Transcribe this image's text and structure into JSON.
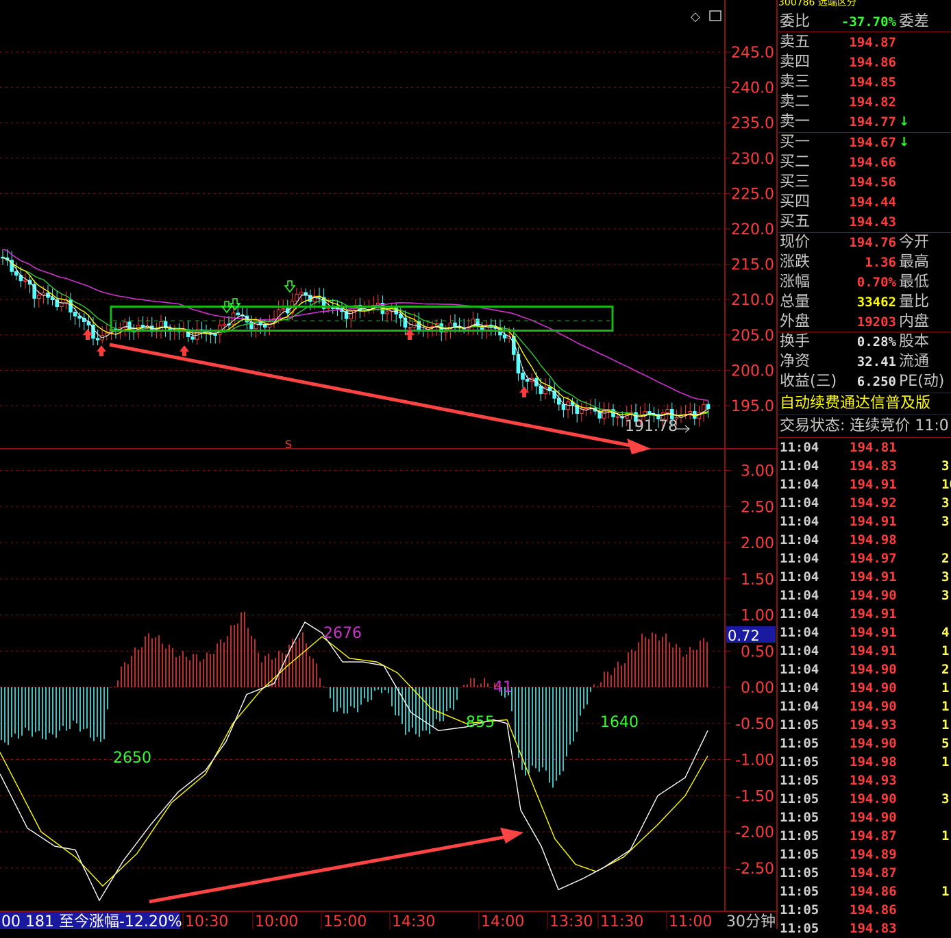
{
  "stock": {
    "code_fragment": "300",
    "header_clip": "300786 远端区分"
  },
  "price_axis": {
    "ticks": [
      "245.0",
      "240.0",
      "235.0",
      "230.0",
      "225.0",
      "220.0",
      "215.0",
      "210.0",
      "205.0",
      "200.0",
      "195.0"
    ]
  },
  "macd_axis": {
    "ticks": [
      "3.00",
      "2.50",
      "2.00",
      "1.50",
      "1.00",
      "0.50",
      "0.00",
      "-0.50",
      "-1.00",
      "-1.50",
      "-2.00",
      "-2.50"
    ],
    "current": "0.72"
  },
  "chart_annotations": {
    "low_price_label": "191.78",
    "s_marker": "S",
    "macd_labels": [
      "2650",
      "2676",
      "41",
      "855",
      "1640"
    ]
  },
  "bottom_bar": {
    "info": "00 181 至今涨幅-12.20%",
    "time_labels": [
      "10:30",
      "10:00",
      "15:00",
      "14:30",
      "14:00",
      "13:30",
      "11:30",
      "11:00"
    ],
    "period": "30分钟"
  },
  "quote": {
    "weibi": {
      "label": "委比",
      "value": "-37.70%",
      "label2": "委差"
    },
    "asks": [
      {
        "label": "卖五",
        "price": "194.87"
      },
      {
        "label": "卖四",
        "price": "194.86"
      },
      {
        "label": "卖三",
        "price": "194.85"
      },
      {
        "label": "卖二",
        "price": "194.82"
      },
      {
        "label": "卖一",
        "price": "194.77"
      }
    ],
    "bids": [
      {
        "label": "买一",
        "price": "194.67"
      },
      {
        "label": "买二",
        "price": "194.66"
      },
      {
        "label": "买三",
        "price": "194.56"
      },
      {
        "label": "买四",
        "price": "194.44"
      },
      {
        "label": "买五",
        "price": "194.43"
      }
    ],
    "stats": [
      {
        "label": "现价",
        "value": "194.76",
        "label2": "今开",
        "color": "red"
      },
      {
        "label": "涨跌",
        "value": "1.36",
        "label2": "最高",
        "color": "red"
      },
      {
        "label": "涨幅",
        "value": "0.70%",
        "label2": "最低",
        "color": "red"
      },
      {
        "label": "总量",
        "value": "33462",
        "label2": "量比",
        "color": "yellow"
      },
      {
        "label": "外盘",
        "value": "19203",
        "label2": "内盘",
        "color": "red"
      }
    ],
    "stats2": [
      {
        "label": "换手",
        "value": "0.28%",
        "label2": "股本"
      },
      {
        "label": "净资",
        "value": "32.41",
        "label2": "流通"
      },
      {
        "label": "收益(三)",
        "value": "6.250",
        "label2": "PE(动)"
      }
    ],
    "banner": "自动续费通达信普及版",
    "trade_status": "交易状态: 连续竞价 11:0"
  },
  "ticks": [
    {
      "time": "11:04",
      "price": "194.81",
      "vol": ""
    },
    {
      "time": "11:04",
      "price": "194.83",
      "vol": "3"
    },
    {
      "time": "11:04",
      "price": "194.91",
      "vol": "10"
    },
    {
      "time": "11:04",
      "price": "194.92",
      "vol": "3"
    },
    {
      "time": "11:04",
      "price": "194.91",
      "vol": "3"
    },
    {
      "time": "11:04",
      "price": "194.98",
      "vol": ""
    },
    {
      "time": "11:04",
      "price": "194.97",
      "vol": "2"
    },
    {
      "time": "11:04",
      "price": "194.91",
      "vol": "3"
    },
    {
      "time": "11:04",
      "price": "194.90",
      "vol": "3"
    },
    {
      "time": "11:04",
      "price": "194.91",
      "vol": ""
    },
    {
      "time": "11:04",
      "price": "194.91",
      "vol": "4"
    },
    {
      "time": "11:04",
      "price": "194.91",
      "vol": "1"
    },
    {
      "time": "11:04",
      "price": "194.90",
      "vol": "2"
    },
    {
      "time": "11:04",
      "price": "194.90",
      "vol": "1"
    },
    {
      "time": "11:04",
      "price": "194.90",
      "vol": "1"
    },
    {
      "time": "11:05",
      "price": "194.93",
      "vol": "1"
    },
    {
      "time": "11:05",
      "price": "194.90",
      "vol": "5"
    },
    {
      "time": "11:05",
      "price": "194.98",
      "vol": "1"
    },
    {
      "time": "11:05",
      "price": "194.93",
      "vol": ""
    },
    {
      "time": "11:05",
      "price": "194.90",
      "vol": "3"
    },
    {
      "time": "11:05",
      "price": "194.90",
      "vol": ""
    },
    {
      "time": "11:05",
      "price": "194.87",
      "vol": "1"
    },
    {
      "time": "11:05",
      "price": "194.89",
      "vol": ""
    },
    {
      "time": "11:05",
      "price": "194.87",
      "vol": ""
    },
    {
      "time": "11:05",
      "price": "194.86",
      "vol": "1"
    },
    {
      "time": "11:05",
      "price": "194.86",
      "vol": ""
    },
    {
      "time": "11:05",
      "price": "194.83",
      "vol": ""
    }
  ],
  "colors": {
    "up": "#ff3b3b",
    "down": "#54ffff",
    "ma5": "#ffffff",
    "ma10": "#ffff00",
    "ma20": "#33cc33",
    "ma60": "#cc33cc",
    "grid": "#8b1010",
    "box": "#1db31d",
    "arrow": "#ff3b3b"
  }
}
